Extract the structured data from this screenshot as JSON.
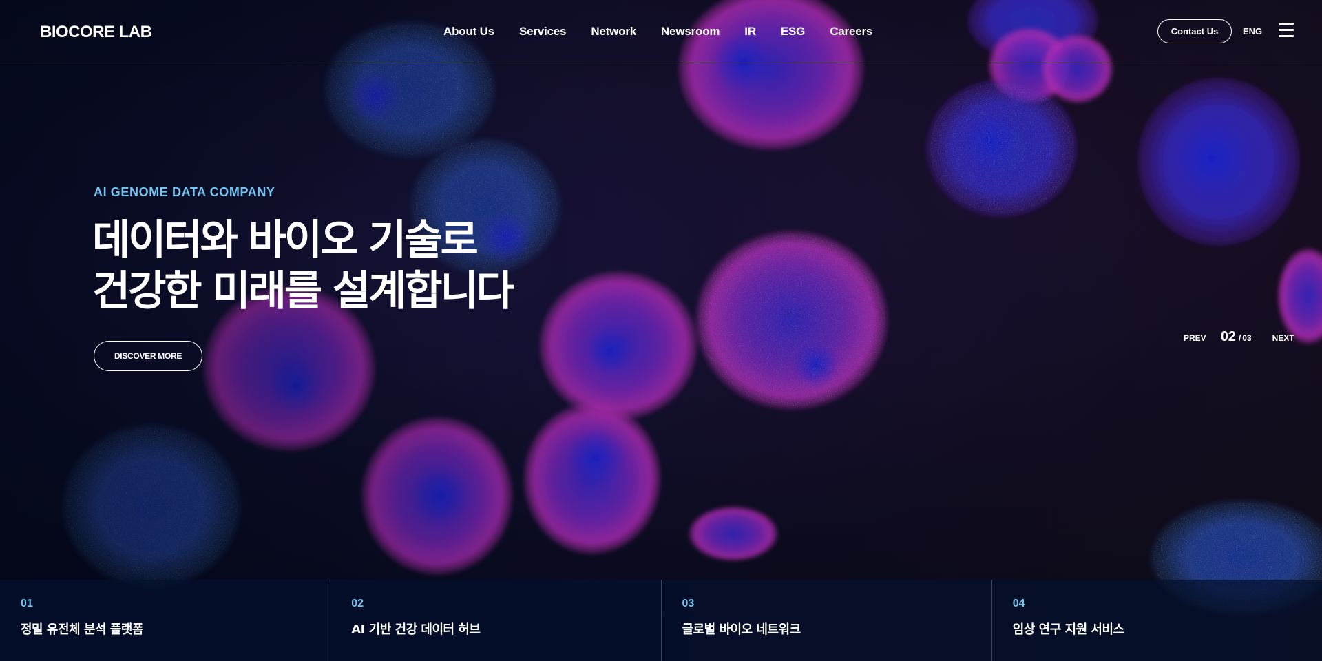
{
  "header": {
    "logo": "BIOCORE LAB",
    "nav": [
      "About Us",
      "Services",
      "Network",
      "Newsroom",
      "IR",
      "ESG",
      "Careers"
    ],
    "contact_label": "Contact Us",
    "lang_label": "ENG",
    "menu_icon": "hamburger-menu-icon"
  },
  "hero": {
    "eyebrow": "AI GENOME DATA COMPANY",
    "headline_line1": "데이터와 바이오 기술로",
    "headline_line2": "건강한 미래를 설계합니다",
    "cta_label": "DISCOVER MORE",
    "background": "fluorescent-cells-microscopy-image"
  },
  "slider": {
    "prev_label": "PREV",
    "current": "02",
    "separator": "/",
    "total": "03",
    "next_label": "NEXT"
  },
  "cards": [
    {
      "num": "01",
      "title": "정밀 유전체 분석 플랫폼"
    },
    {
      "num": "02",
      "title": "AI 기반 건강 데이터 허브"
    },
    {
      "num": "03",
      "title": "글로벌 바이오 네트워크"
    },
    {
      "num": "04",
      "title": "임상 연구 지원 서비스"
    }
  ],
  "colors": {
    "accent": "#74c4f2",
    "background": "#05081a",
    "card_bar": "#04102e"
  }
}
